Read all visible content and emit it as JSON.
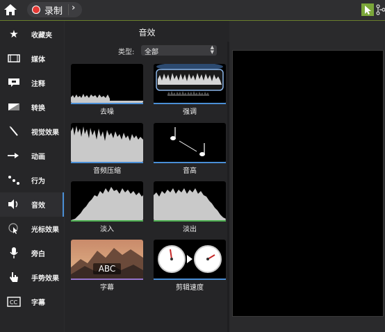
{
  "toolbar": {
    "record_label": "录制",
    "record_menu_icon": "chevron-right-icon",
    "home_icon": "home-icon",
    "tools": [
      "cursor-select-icon",
      "node-graph-icon"
    ],
    "accent": "#7ba73a"
  },
  "sidebar": {
    "items": [
      {
        "label": "收藏夹",
        "icon": "star-icon"
      },
      {
        "label": "媒体",
        "icon": "film-icon"
      },
      {
        "label": "注释",
        "icon": "annotation-icon"
      },
      {
        "label": "转换",
        "icon": "transition-icon"
      },
      {
        "label": "视觉效果",
        "icon": "magic-wand-icon"
      },
      {
        "label": "动画",
        "icon": "animation-arrow-icon"
      },
      {
        "label": "行为",
        "icon": "behavior-dots-icon"
      },
      {
        "label": "音效",
        "icon": "speaker-icon",
        "active": true
      },
      {
        "label": "光标效果",
        "icon": "cursor-effect-icon"
      },
      {
        "label": "旁白",
        "icon": "microphone-icon"
      },
      {
        "label": "手势效果",
        "icon": "hand-gesture-icon"
      },
      {
        "label": "字幕",
        "icon": "cc-icon"
      }
    ]
  },
  "library": {
    "title": "音效",
    "filter_label": "类型:",
    "filter_value": "全部",
    "tiles": [
      {
        "label": "去噪",
        "line_color": "#4a8fd6"
      },
      {
        "label": "强调",
        "line_color": "#4a8fd6"
      },
      {
        "label": "音频压缩",
        "line_color": "#4a8fd6"
      },
      {
        "label": "音高",
        "line_color": "#4a8fd6"
      },
      {
        "label": "淡入",
        "line_color": "#4caf50"
      },
      {
        "label": "淡出",
        "line_color": "#4caf50"
      },
      {
        "label": "字幕",
        "line_color": "#9575cd",
        "thumb_text": "ABC"
      },
      {
        "label": "剪辑速度",
        "line_color": "#4a8fd6"
      }
    ]
  }
}
